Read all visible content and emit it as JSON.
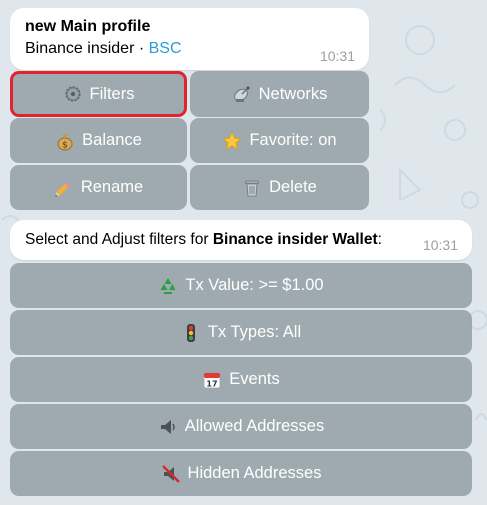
{
  "message1": {
    "title": "new Main profile",
    "subtitle_prefix": "Binance insider · ",
    "subtitle_link": "BSC",
    "time": "10:31"
  },
  "keyboard1": {
    "filters": "Filters",
    "networks": "Networks",
    "balance": "Balance",
    "favorite": "Favorite: on",
    "rename": "Rename",
    "delete": "Delete"
  },
  "message2": {
    "text_prefix": "Select and Adjust filters for ",
    "text_bold": "Binance insider Wallet",
    "text_suffix": ":",
    "time": "10:31"
  },
  "keyboard2": {
    "tx_value": "Tx Value: >= $1.00",
    "tx_types": "Tx Types: All",
    "events": "Events",
    "allowed": "Allowed Addresses",
    "hidden": "Hidden Addresses"
  },
  "icons": {
    "filters": "gear-icon",
    "networks": "satellite-icon",
    "balance": "money-bag-icon",
    "favorite": "star-icon",
    "rename": "pencil-icon",
    "delete": "trash-icon",
    "tx_value": "recycle-icon",
    "tx_types": "traffic-light-icon",
    "events": "calendar-icon",
    "allowed": "speaker-icon",
    "hidden": "muted-speaker-icon"
  },
  "colors": {
    "link": "#2a9ed6",
    "selection": "#e0232d",
    "button": "#8c989e"
  }
}
